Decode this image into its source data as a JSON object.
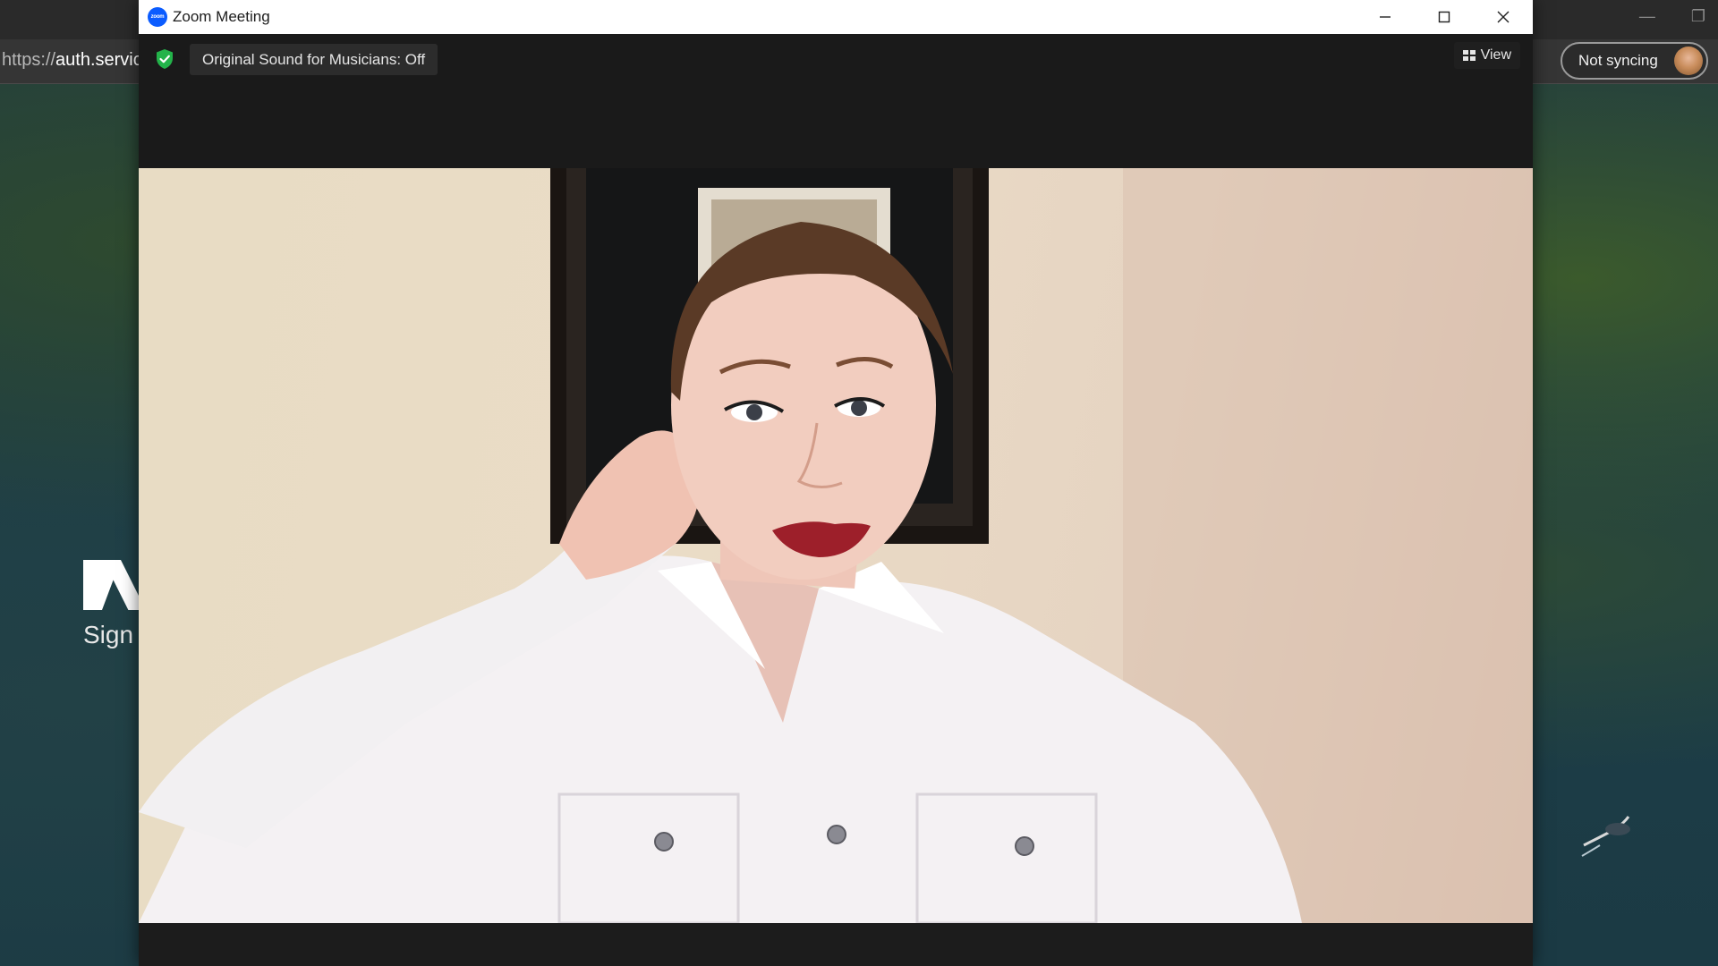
{
  "background_browser": {
    "url_scheme": "https://",
    "url_host": "auth.servic",
    "page_heading": "Sign i",
    "sync_button_label": "Not syncing"
  },
  "zoom": {
    "window_title": "Zoom Meeting",
    "app_icon_text": "zoom",
    "original_sound_label": "Original Sound for Musicians: Off",
    "view_button_label": "View",
    "security_status_color": "#23b34a",
    "brand_color": "#0b5cff"
  },
  "icons": {
    "minimize": "minimize-icon",
    "maximize": "maximize-icon",
    "close": "close-icon",
    "security": "shield-check-icon",
    "view": "grid-icon"
  }
}
